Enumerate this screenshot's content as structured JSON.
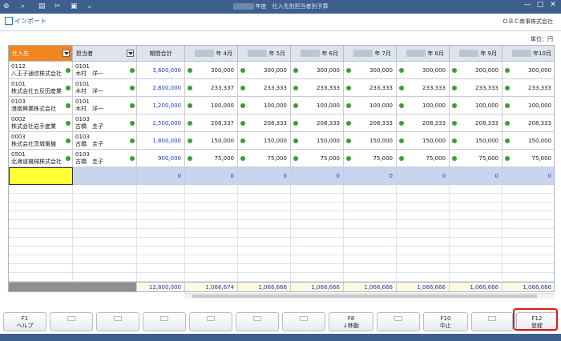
{
  "window": {
    "title": "年度　仕入先別担当者別予算",
    "controls": [
      "—",
      "□",
      "✕"
    ]
  },
  "toolbar": {
    "import_label": "インポート",
    "company": "ＯＢＣ商事株式会社"
  },
  "unit_label": "単位：円",
  "table": {
    "headers": [
      "仕入先",
      "担当者",
      "期間合計",
      "年 4月",
      "年 5月",
      "年 6月",
      "年 7月",
      "年 8月",
      "年 9月",
      "年10月"
    ],
    "rows": [
      {
        "supplier_code": "0112",
        "supplier_name": "八王子通信株式会社",
        "staff_code": "0101",
        "staff_name": "木村　洋一",
        "total": "3,600,000",
        "months": [
          "300,000",
          "300,000",
          "300,000",
          "300,000",
          "300,000",
          "300,000",
          "300,000"
        ]
      },
      {
        "supplier_code": "0101",
        "supplier_name": "株式会社五反田産業",
        "staff_code": "0101",
        "staff_name": "木村　洋一",
        "total": "2,800,000",
        "months": [
          "233,337",
          "233,333",
          "233,333",
          "233,333",
          "233,333",
          "233,333",
          "233,333"
        ]
      },
      {
        "supplier_code": "0103",
        "supplier_name": "港南興業株式会社",
        "staff_code": "0101",
        "staff_name": "木村　洋一",
        "total": "1,200,000",
        "months": [
          "100,000",
          "100,000",
          "100,000",
          "100,000",
          "100,000",
          "100,000",
          "100,000"
        ]
      },
      {
        "supplier_code": "0002",
        "supplier_name": "株式会社岩手産業",
        "staff_code": "0103",
        "staff_name": "古橋　圭子",
        "total": "2,500,000",
        "months": [
          "208,337",
          "208,333",
          "208,333",
          "208,333",
          "208,333",
          "208,333",
          "208,333"
        ]
      },
      {
        "supplier_code": "0003",
        "supplier_name": "株式会社茨城電機",
        "staff_code": "0103",
        "staff_name": "古橋　圭子",
        "total": "1,800,000",
        "months": [
          "150,000",
          "150,000",
          "150,000",
          "150,000",
          "150,000",
          "150,000",
          "150,000"
        ]
      },
      {
        "supplier_code": "0501",
        "supplier_name": "北海道機械株式会社",
        "staff_code": "0103",
        "staff_name": "古橋　圭子",
        "total": "900,000",
        "months": [
          "75,000",
          "75,000",
          "75,000",
          "75,000",
          "75,000",
          "75,000",
          "75,000"
        ]
      }
    ],
    "input_row": {
      "total": "0",
      "months": [
        "0",
        "0",
        "0",
        "0",
        "0",
        "0",
        "0"
      ]
    },
    "footer": {
      "total": "12,800,000",
      "months": [
        "1,066,674",
        "1,066,666",
        "1,066,666",
        "1,066,666",
        "1,066,666",
        "1,066,666",
        "1,066,666"
      ]
    }
  },
  "fkeys": [
    {
      "key": "F1",
      "label": "ヘルプ"
    },
    {
      "key": "",
      "label": ""
    },
    {
      "key": "",
      "label": ""
    },
    {
      "key": "",
      "label": ""
    },
    {
      "key": "",
      "label": ""
    },
    {
      "key": "",
      "label": ""
    },
    {
      "key": "",
      "label": ""
    },
    {
      "key": "F8",
      "label": "↓移動"
    },
    {
      "key": "",
      "label": ""
    },
    {
      "key": "F10",
      "label": "中止"
    },
    {
      "key": "",
      "label": ""
    },
    {
      "key": "F12",
      "label": "登録"
    }
  ],
  "colors": {
    "titlebar": "#3c5f8e",
    "header_active": "#f0861e",
    "value_blue": "#1d3fbf",
    "status_dot": "#3f9b3f",
    "highlight": "#e01818"
  }
}
